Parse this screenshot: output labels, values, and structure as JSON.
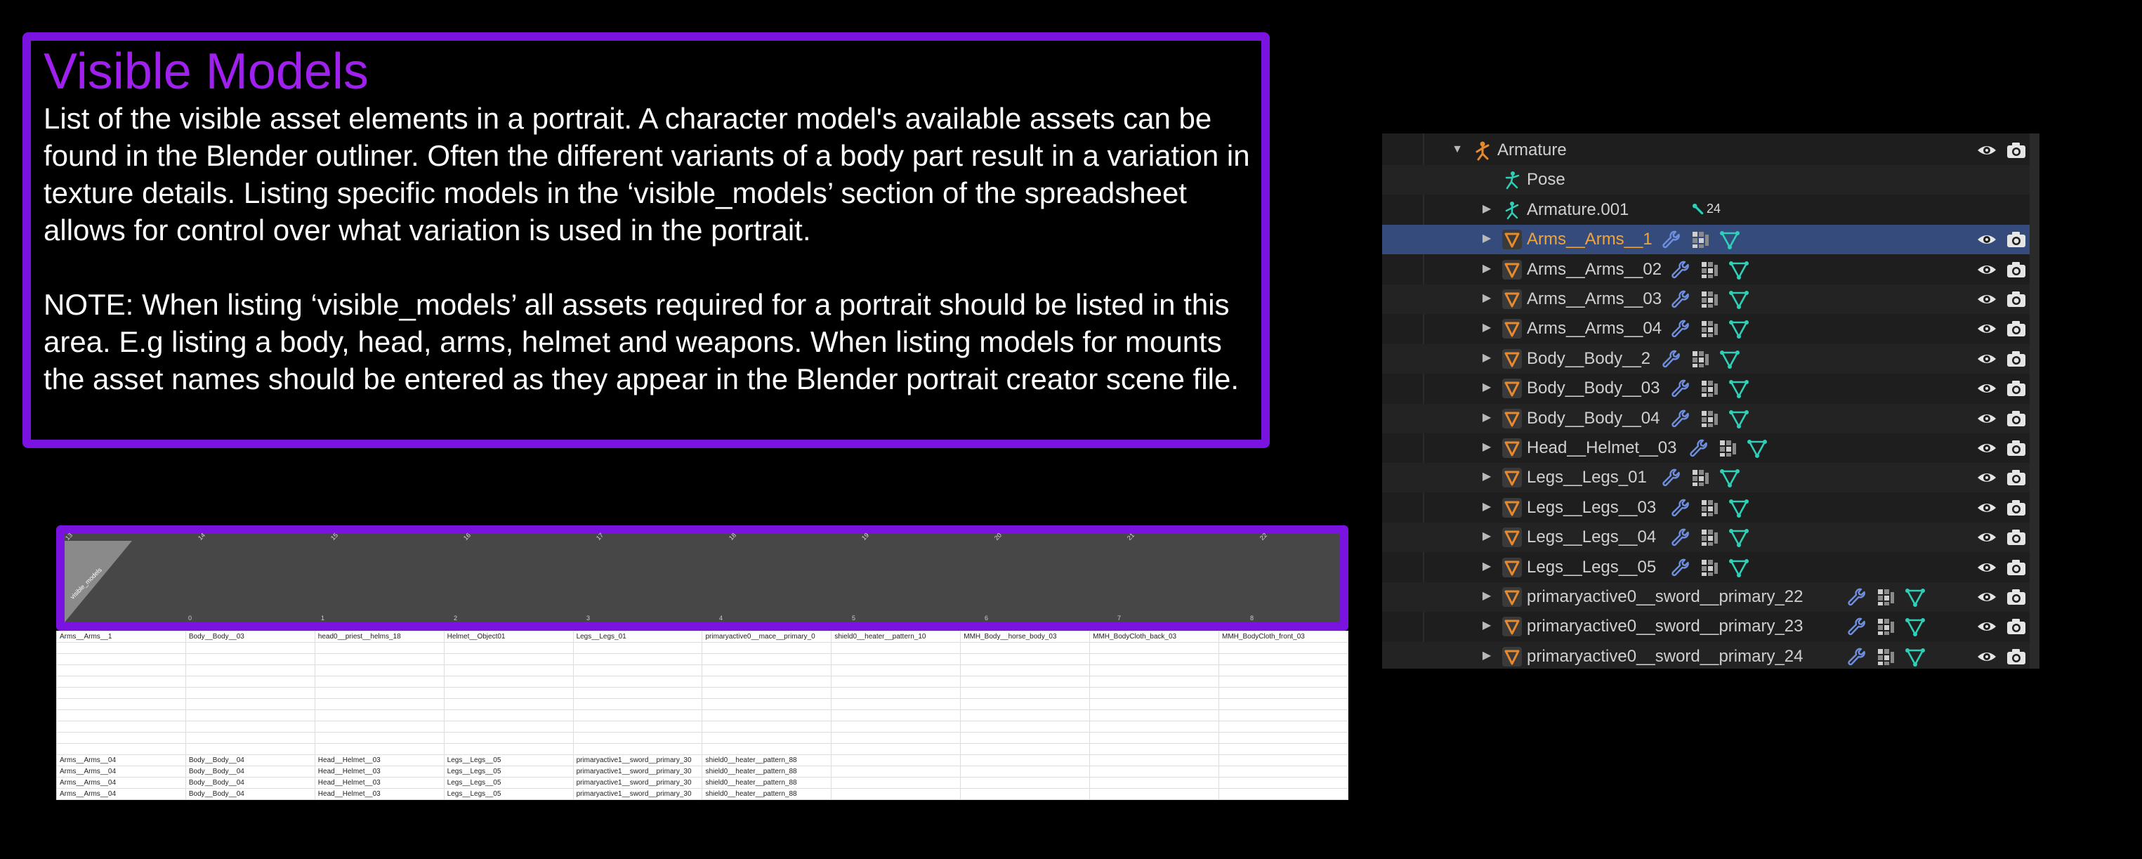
{
  "info": {
    "title": "Visible Models",
    "paragraph1": "List of the visible asset elements in a portrait. A character model's available assets can be found in the Blender outliner. Often the different variants of a body part result in a variation in texture details. Listing specific models in the ‘visible_models’ section of the spreadsheet allows for control over what variation is used in the portrait.",
    "paragraph2": "NOTE: When listing ‘visible_models’ all assets required for a portrait should be listed in this area. E.g listing a body, head, arms, helmet and weapons. When listing models for mounts the asset names should be entered as they appear in the Blender portrait creator scene file."
  },
  "spreadsheet": {
    "corner_label": "visible_models",
    "column_numbers": [
      "13",
      "14",
      "15",
      "16",
      "17",
      "18",
      "19",
      "20",
      "21",
      "22"
    ],
    "column_indices": [
      "0",
      "1",
      "2",
      "3",
      "4",
      "5",
      "6",
      "7",
      "8"
    ],
    "rows": [
      [
        "Arms__Arms__1",
        "Body__Body__03",
        "head0__priest__helms_18",
        "Helmet__Object01",
        "Legs__Legs_01",
        "primaryactive0__mace__primary_0",
        "shield0__heater__pattern_10",
        "MMH_Body__horse_body_03",
        "MMH_BodyCloth_back_03",
        "MMH_BodyCloth_front_03"
      ],
      [
        "",
        "",
        "",
        "",
        "",
        "",
        "",
        "",
        "",
        ""
      ],
      [
        "",
        "",
        "",
        "",
        "",
        "",
        "",
        "",
        "",
        ""
      ],
      [
        "",
        "",
        "",
        "",
        "",
        "",
        "",
        "",
        "",
        ""
      ],
      [
        "",
        "",
        "",
        "",
        "",
        "",
        "",
        "",
        "",
        ""
      ],
      [
        "",
        "",
        "",
        "",
        "",
        "",
        "",
        "",
        "",
        ""
      ],
      [
        "",
        "",
        "",
        "",
        "",
        "",
        "",
        "",
        "",
        ""
      ],
      [
        "",
        "",
        "",
        "",
        "",
        "",
        "",
        "",
        "",
        ""
      ],
      [
        "",
        "",
        "",
        "",
        "",
        "",
        "",
        "",
        "",
        ""
      ],
      [
        "",
        "",
        "",
        "",
        "",
        "",
        "",
        "",
        "",
        ""
      ],
      [
        "",
        "",
        "",
        "",
        "",
        "",
        "",
        "",
        "",
        ""
      ],
      [
        "Arms__Arms__04",
        "Body__Body__04",
        "Head__Helmet__03",
        "Legs__Legs__05",
        "primaryactive1__sword__primary_30",
        "shield0__heater__pattern_88",
        "",
        "",
        "",
        ""
      ],
      [
        "Arms__Arms__04",
        "Body__Body__04",
        "Head__Helmet__03",
        "Legs__Legs__05",
        "primaryactive1__sword__primary_30",
        "shield0__heater__pattern_88",
        "",
        "",
        "",
        ""
      ],
      [
        "Arms__Arms__04",
        "Body__Body__04",
        "Head__Helmet__03",
        "Legs__Legs__05",
        "primaryactive1__sword__primary_30",
        "shield0__heater__pattern_88",
        "",
        "",
        "",
        ""
      ],
      [
        "Arms__Arms__04",
        "Body__Body__04",
        "Head__Helmet__03",
        "Legs__Legs__05",
        "primaryactive1__sword__primary_30",
        "shield0__heater__pattern_88",
        "",
        "",
        "",
        ""
      ]
    ]
  },
  "outliner": {
    "items": [
      {
        "label": "Armature",
        "icon": "armature-icon",
        "expanded": true,
        "selected": false,
        "badge": "",
        "visibility": true
      },
      {
        "label": "Pose",
        "icon": "pose-icon",
        "expanded": false,
        "selected": false,
        "badge": "",
        "visibility": false
      },
      {
        "label": "Armature.001",
        "icon": "armature-data-icon",
        "expanded": false,
        "selected": false,
        "badge": "24",
        "visibility": false
      },
      {
        "label": "Arms__Arms__1",
        "icon": "mesh-icon",
        "expanded": false,
        "selected": true,
        "badge": "",
        "visibility": true
      },
      {
        "label": "Arms__Arms__02",
        "icon": "mesh-icon",
        "expanded": false,
        "selected": false,
        "badge": "",
        "visibility": true
      },
      {
        "label": "Arms__Arms__03",
        "icon": "mesh-icon",
        "expanded": false,
        "selected": false,
        "badge": "",
        "visibility": true
      },
      {
        "label": "Arms__Arms__04",
        "icon": "mesh-icon",
        "expanded": false,
        "selected": false,
        "badge": "",
        "visibility": true
      },
      {
        "label": "Body__Body__2",
        "icon": "mesh-icon",
        "expanded": false,
        "selected": false,
        "badge": "",
        "visibility": true
      },
      {
        "label": "Body__Body__03",
        "icon": "mesh-icon",
        "expanded": false,
        "selected": false,
        "badge": "",
        "visibility": true
      },
      {
        "label": "Body__Body__04",
        "icon": "mesh-icon",
        "expanded": false,
        "selected": false,
        "badge": "",
        "visibility": true
      },
      {
        "label": "Head__Helmet__03",
        "icon": "mesh-icon",
        "expanded": false,
        "selected": false,
        "badge": "",
        "visibility": true
      },
      {
        "label": "Legs__Legs_01",
        "icon": "mesh-icon",
        "expanded": false,
        "selected": false,
        "badge": "",
        "visibility": true
      },
      {
        "label": "Legs__Legs__03",
        "icon": "mesh-icon",
        "expanded": false,
        "selected": false,
        "badge": "",
        "visibility": true
      },
      {
        "label": "Legs__Legs__04",
        "icon": "mesh-icon",
        "expanded": false,
        "selected": false,
        "badge": "",
        "visibility": true
      },
      {
        "label": "Legs__Legs__05",
        "icon": "mesh-icon",
        "expanded": false,
        "selected": false,
        "badge": "",
        "visibility": true
      },
      {
        "label": "primaryactive0__sword__primary_22",
        "icon": "mesh-icon",
        "expanded": false,
        "selected": false,
        "badge": "",
        "visibility": true
      },
      {
        "label": "primaryactive0__sword__primary_23",
        "icon": "mesh-icon",
        "expanded": false,
        "selected": false,
        "badge": "",
        "visibility": true
      },
      {
        "label": "primaryactive0__sword__primary_24",
        "icon": "mesh-icon",
        "expanded": false,
        "selected": false,
        "badge": "",
        "visibility": true
      }
    ]
  },
  "colors": {
    "accent_purple": "#7a12e0",
    "title_purple": "#a020f0",
    "outliner_bg": "#1e1e1e",
    "selected_row": "#344b7b",
    "selected_text": "#f0a63a",
    "mesh_orange": "#e8892e",
    "modifier_blue": "#6f8fe0",
    "vertex_group_teal": "#2fd0b8"
  }
}
